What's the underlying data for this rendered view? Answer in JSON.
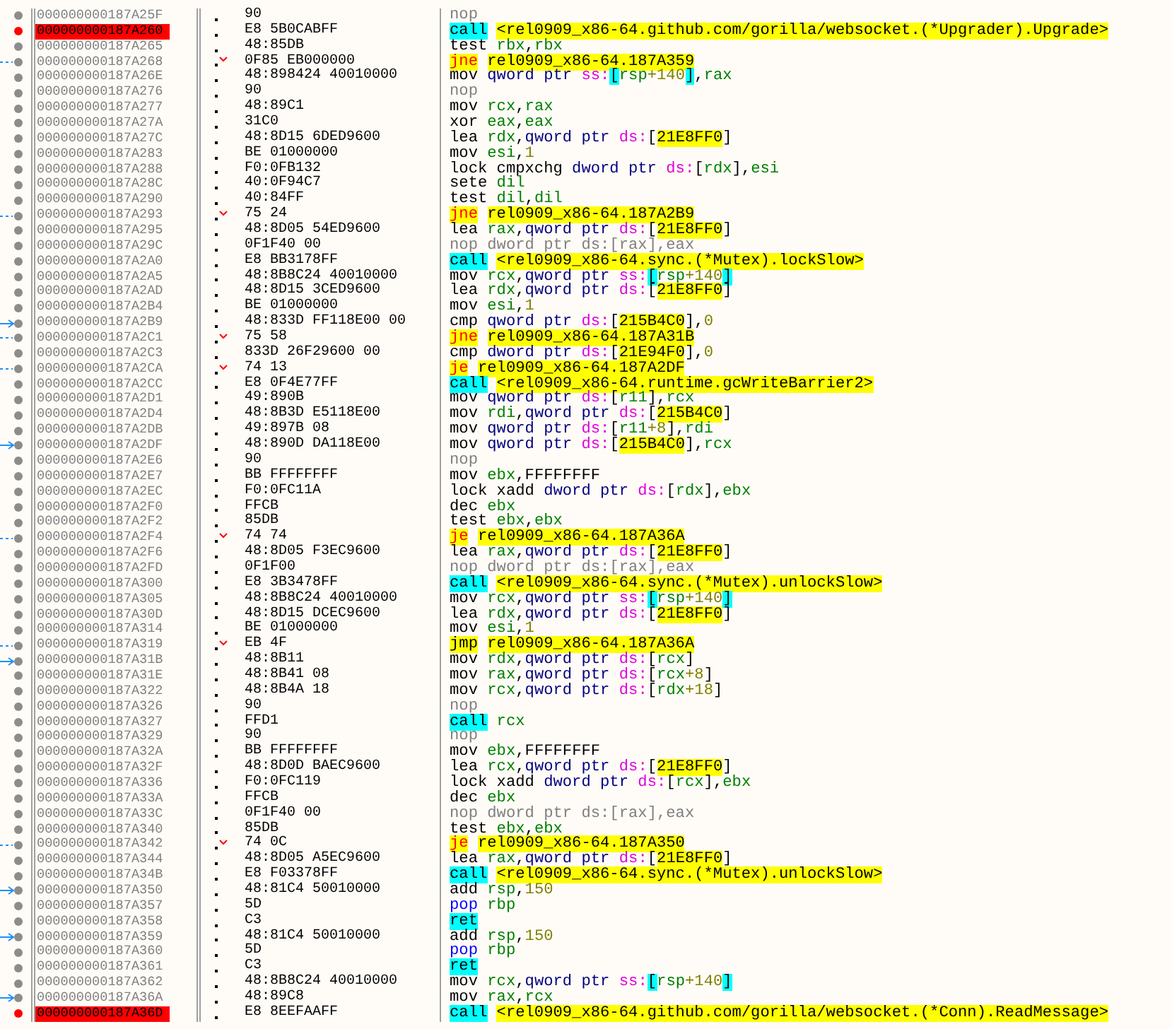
{
  "rows": [
    {
      "address": "000000000187A25F",
      "bytes": "90",
      "breakpoint": false,
      "kind": "plain",
      "mnemonic": {
        "kind": "nop",
        "text": "nop"
      },
      "operands": []
    },
    {
      "address": "000000000187A260",
      "bytes": "E8 5B0CABFF",
      "breakpoint": true,
      "kind": "plain",
      "mnemonic": {
        "kind": "call",
        "text": "call"
      },
      "operands": [
        {
          "kind": "label",
          "text": "<rel0909_x86-64.github.com/gorilla/websocket.(*Upgrader).Upgrade>"
        }
      ]
    },
    {
      "address": "000000000187A265",
      "bytes": "48:85DB",
      "breakpoint": false,
      "kind": "plain",
      "mnemonic": {
        "kind": "op",
        "text": "test"
      },
      "operands": [
        {
          "kind": "reg",
          "text": "rbx"
        },
        {
          "kind": "op",
          "text": ","
        },
        {
          "kind": "reg",
          "text": "rbx"
        }
      ]
    },
    {
      "address": "000000000187A268",
      "bytes": "0F85 EB000000",
      "breakpoint": false,
      "kind": "jump",
      "mnemonic": {
        "kind": "jcc",
        "text": "jne"
      },
      "operands": [
        {
          "kind": "label",
          "text": "rel0909_x86-64.187A359"
        }
      ]
    },
    {
      "address": "000000000187A26E",
      "bytes": "48:898424 40010000",
      "breakpoint": false,
      "kind": "plain",
      "mnemonic": {
        "kind": "op",
        "text": "mov"
      },
      "operands": [
        {
          "kind": "size",
          "text": "qword ptr "
        },
        {
          "kind": "seg",
          "text": "ss:"
        },
        {
          "kind": "sbr",
          "text": "["
        },
        {
          "kind": "reg",
          "text": "rsp"
        },
        {
          "kind": "num",
          "text": "+140"
        },
        {
          "kind": "sbr",
          "text": "]"
        },
        {
          "kind": "op",
          "text": ","
        },
        {
          "kind": "reg",
          "text": "rax"
        }
      ]
    },
    {
      "address": "000000000187A276",
      "bytes": "90",
      "breakpoint": false,
      "kind": "plain",
      "mnemonic": {
        "kind": "nop",
        "text": "nop"
      },
      "operands": []
    },
    {
      "address": "000000000187A277",
      "bytes": "48:89C1",
      "breakpoint": false,
      "kind": "plain",
      "mnemonic": {
        "kind": "op",
        "text": "mov"
      },
      "operands": [
        {
          "kind": "reg",
          "text": "rcx"
        },
        {
          "kind": "op",
          "text": ","
        },
        {
          "kind": "reg",
          "text": "rax"
        }
      ]
    },
    {
      "address": "000000000187A27A",
      "bytes": "31C0",
      "breakpoint": false,
      "kind": "plain",
      "mnemonic": {
        "kind": "op",
        "text": "xor"
      },
      "operands": [
        {
          "kind": "reg",
          "text": "eax"
        },
        {
          "kind": "op",
          "text": ","
        },
        {
          "kind": "reg",
          "text": "eax"
        }
      ]
    },
    {
      "address": "000000000187A27C",
      "bytes": "48:8D15 6DED9600",
      "breakpoint": false,
      "kind": "plain",
      "mnemonic": {
        "kind": "op",
        "text": "lea"
      },
      "operands": [
        {
          "kind": "reg",
          "text": "rdx"
        },
        {
          "kind": "op",
          "text": ","
        },
        {
          "kind": "size",
          "text": "qword ptr "
        },
        {
          "kind": "seg",
          "text": "ds:"
        },
        {
          "kind": "op",
          "text": "["
        },
        {
          "kind": "addr",
          "text": "21E8FF0"
        },
        {
          "kind": "op",
          "text": "]"
        }
      ]
    },
    {
      "address": "000000000187A283",
      "bytes": "BE 01000000",
      "breakpoint": false,
      "kind": "plain",
      "mnemonic": {
        "kind": "op",
        "text": "mov"
      },
      "operands": [
        {
          "kind": "reg",
          "text": "esi"
        },
        {
          "kind": "op",
          "text": ","
        },
        {
          "kind": "num",
          "text": "1"
        }
      ]
    },
    {
      "address": "000000000187A288",
      "bytes": "F0:0FB132",
      "breakpoint": false,
      "kind": "plain",
      "mnemonic": {
        "kind": "op",
        "text": "lock cmpxchg"
      },
      "operands": [
        {
          "kind": "size",
          "text": "dword ptr "
        },
        {
          "kind": "seg",
          "text": "ds:"
        },
        {
          "kind": "op",
          "text": "["
        },
        {
          "kind": "reg",
          "text": "rdx"
        },
        {
          "kind": "op",
          "text": "],"
        },
        {
          "kind": "reg",
          "text": "esi"
        }
      ]
    },
    {
      "address": "000000000187A28C",
      "bytes": "40:0F94C7",
      "breakpoint": false,
      "kind": "plain",
      "mnemonic": {
        "kind": "op",
        "text": "sete"
      },
      "operands": [
        {
          "kind": "reg",
          "text": "dil"
        }
      ]
    },
    {
      "address": "000000000187A290",
      "bytes": "40:84FF",
      "breakpoint": false,
      "kind": "plain",
      "mnemonic": {
        "kind": "op",
        "text": "test"
      },
      "operands": [
        {
          "kind": "reg",
          "text": "dil"
        },
        {
          "kind": "op",
          "text": ","
        },
        {
          "kind": "reg",
          "text": "dil"
        }
      ]
    },
    {
      "address": "000000000187A293",
      "bytes": "75 24",
      "breakpoint": false,
      "kind": "jump",
      "mnemonic": {
        "kind": "jcc",
        "text": "jne"
      },
      "operands": [
        {
          "kind": "label",
          "text": "rel0909_x86-64.187A2B9"
        }
      ]
    },
    {
      "address": "000000000187A295",
      "bytes": "48:8D05 54ED9600",
      "breakpoint": false,
      "kind": "plain",
      "mnemonic": {
        "kind": "op",
        "text": "lea"
      },
      "operands": [
        {
          "kind": "reg",
          "text": "rax"
        },
        {
          "kind": "op",
          "text": ","
        },
        {
          "kind": "size",
          "text": "qword ptr "
        },
        {
          "kind": "seg",
          "text": "ds:"
        },
        {
          "kind": "op",
          "text": "["
        },
        {
          "kind": "addr",
          "text": "21E8FF0"
        },
        {
          "kind": "op",
          "text": "]"
        }
      ]
    },
    {
      "address": "000000000187A29C",
      "bytes": "0F1F40 00",
      "breakpoint": false,
      "kind": "plain",
      "mnemonic": {
        "kind": "nop",
        "text": "nop"
      },
      "operands": [
        {
          "kind": "nop",
          "text": "dword ptr ds:[rax],eax"
        }
      ]
    },
    {
      "address": "000000000187A2A0",
      "bytes": "E8 BB3178FF",
      "breakpoint": false,
      "kind": "plain",
      "mnemonic": {
        "kind": "call",
        "text": "call"
      },
      "operands": [
        {
          "kind": "label",
          "text": "<rel0909_x86-64.sync.(*Mutex).lockSlow>"
        }
      ]
    },
    {
      "address": "000000000187A2A5",
      "bytes": "48:8B8C24 40010000",
      "breakpoint": false,
      "kind": "plain",
      "mnemonic": {
        "kind": "op",
        "text": "mov"
      },
      "operands": [
        {
          "kind": "reg",
          "text": "rcx"
        },
        {
          "kind": "op",
          "text": ","
        },
        {
          "kind": "size",
          "text": "qword ptr "
        },
        {
          "kind": "seg",
          "text": "ss:"
        },
        {
          "kind": "sbr",
          "text": "["
        },
        {
          "kind": "reg",
          "text": "rsp"
        },
        {
          "kind": "num",
          "text": "+140"
        },
        {
          "kind": "sbr",
          "text": "]"
        }
      ]
    },
    {
      "address": "000000000187A2AD",
      "bytes": "48:8D15 3CED9600",
      "breakpoint": false,
      "kind": "plain",
      "mnemonic": {
        "kind": "op",
        "text": "lea"
      },
      "operands": [
        {
          "kind": "reg",
          "text": "rdx"
        },
        {
          "kind": "op",
          "text": ","
        },
        {
          "kind": "size",
          "text": "qword ptr "
        },
        {
          "kind": "seg",
          "text": "ds:"
        },
        {
          "kind": "op",
          "text": "["
        },
        {
          "kind": "addr",
          "text": "21E8FF0"
        },
        {
          "kind": "op",
          "text": "]"
        }
      ]
    },
    {
      "address": "000000000187A2B4",
      "bytes": "BE 01000000",
      "breakpoint": false,
      "kind": "plain",
      "mnemonic": {
        "kind": "op",
        "text": "mov"
      },
      "operands": [
        {
          "kind": "reg",
          "text": "esi"
        },
        {
          "kind": "op",
          "text": ","
        },
        {
          "kind": "num",
          "text": "1"
        }
      ]
    },
    {
      "address": "000000000187A2B9",
      "bytes": "48:833D FF118E00 00",
      "breakpoint": false,
      "kind": "target",
      "mnemonic": {
        "kind": "op",
        "text": "cmp"
      },
      "operands": [
        {
          "kind": "size",
          "text": "qword ptr "
        },
        {
          "kind": "seg",
          "text": "ds:"
        },
        {
          "kind": "op",
          "text": "["
        },
        {
          "kind": "addr",
          "text": "215B4C0"
        },
        {
          "kind": "op",
          "text": "],"
        },
        {
          "kind": "num",
          "text": "0"
        }
      ]
    },
    {
      "address": "000000000187A2C1",
      "bytes": "75 58",
      "breakpoint": false,
      "kind": "jump",
      "mnemonic": {
        "kind": "jcc",
        "text": "jne"
      },
      "operands": [
        {
          "kind": "label",
          "text": "rel0909_x86-64.187A31B"
        }
      ]
    },
    {
      "address": "000000000187A2C3",
      "bytes": "833D 26F29600 00",
      "breakpoint": false,
      "kind": "plain",
      "mnemonic": {
        "kind": "op",
        "text": "cmp"
      },
      "operands": [
        {
          "kind": "size",
          "text": "dword ptr "
        },
        {
          "kind": "seg",
          "text": "ds:"
        },
        {
          "kind": "op",
          "text": "["
        },
        {
          "kind": "addr",
          "text": "21E94F0"
        },
        {
          "kind": "op",
          "text": "],"
        },
        {
          "kind": "num",
          "text": "0"
        }
      ]
    },
    {
      "address": "000000000187A2CA",
      "bytes": "74 13",
      "breakpoint": false,
      "kind": "jump",
      "mnemonic": {
        "kind": "jcc",
        "text": "je"
      },
      "operands": [
        {
          "kind": "label",
          "text": "rel0909_x86-64.187A2DF"
        }
      ]
    },
    {
      "address": "000000000187A2CC",
      "bytes": "E8 0F4E77FF",
      "breakpoint": false,
      "kind": "plain",
      "mnemonic": {
        "kind": "call",
        "text": "call"
      },
      "operands": [
        {
          "kind": "label",
          "text": "<rel0909_x86-64.runtime.gcWriteBarrier2>"
        }
      ]
    },
    {
      "address": "000000000187A2D1",
      "bytes": "49:890B",
      "breakpoint": false,
      "kind": "plain",
      "mnemonic": {
        "kind": "op",
        "text": "mov"
      },
      "operands": [
        {
          "kind": "size",
          "text": "qword ptr "
        },
        {
          "kind": "seg",
          "text": "ds:"
        },
        {
          "kind": "op",
          "text": "["
        },
        {
          "kind": "reg",
          "text": "r11"
        },
        {
          "kind": "op",
          "text": "],"
        },
        {
          "kind": "reg",
          "text": "rcx"
        }
      ]
    },
    {
      "address": "000000000187A2D4",
      "bytes": "48:8B3D E5118E00",
      "breakpoint": false,
      "kind": "plain",
      "mnemonic": {
        "kind": "op",
        "text": "mov"
      },
      "operands": [
        {
          "kind": "reg",
          "text": "rdi"
        },
        {
          "kind": "op",
          "text": ","
        },
        {
          "kind": "size",
          "text": "qword ptr "
        },
        {
          "kind": "seg",
          "text": "ds:"
        },
        {
          "kind": "op",
          "text": "["
        },
        {
          "kind": "addr",
          "text": "215B4C0"
        },
        {
          "kind": "op",
          "text": "]"
        }
      ]
    },
    {
      "address": "000000000187A2DB",
      "bytes": "49:897B 08",
      "breakpoint": false,
      "kind": "plain",
      "mnemonic": {
        "kind": "op",
        "text": "mov"
      },
      "operands": [
        {
          "kind": "size",
          "text": "qword ptr "
        },
        {
          "kind": "seg",
          "text": "ds:"
        },
        {
          "kind": "op",
          "text": "["
        },
        {
          "kind": "reg",
          "text": "r11"
        },
        {
          "kind": "num",
          "text": "+8"
        },
        {
          "kind": "op",
          "text": "],"
        },
        {
          "kind": "reg",
          "text": "rdi"
        }
      ]
    },
    {
      "address": "000000000187A2DF",
      "bytes": "48:890D DA118E00",
      "breakpoint": false,
      "kind": "target",
      "mnemonic": {
        "kind": "op",
        "text": "mov"
      },
      "operands": [
        {
          "kind": "size",
          "text": "qword ptr "
        },
        {
          "kind": "seg",
          "text": "ds:"
        },
        {
          "kind": "op",
          "text": "["
        },
        {
          "kind": "addr",
          "text": "215B4C0"
        },
        {
          "kind": "op",
          "text": "],"
        },
        {
          "kind": "reg",
          "text": "rcx"
        }
      ]
    },
    {
      "address": "000000000187A2E6",
      "bytes": "90",
      "breakpoint": false,
      "kind": "plain",
      "mnemonic": {
        "kind": "nop",
        "text": "nop"
      },
      "operands": []
    },
    {
      "address": "000000000187A2E7",
      "bytes": "BB FFFFFFFF",
      "breakpoint": false,
      "kind": "plain",
      "mnemonic": {
        "kind": "op",
        "text": "mov"
      },
      "operands": [
        {
          "kind": "reg",
          "text": "ebx"
        },
        {
          "kind": "op",
          "text": ",FFFFFFFF"
        }
      ]
    },
    {
      "address": "000000000187A2EC",
      "bytes": "F0:0FC11A",
      "breakpoint": false,
      "kind": "plain",
      "mnemonic": {
        "kind": "op",
        "text": "lock xadd"
      },
      "operands": [
        {
          "kind": "size",
          "text": "dword ptr "
        },
        {
          "kind": "seg",
          "text": "ds:"
        },
        {
          "kind": "op",
          "text": "["
        },
        {
          "kind": "reg",
          "text": "rdx"
        },
        {
          "kind": "op",
          "text": "],"
        },
        {
          "kind": "reg",
          "text": "ebx"
        }
      ]
    },
    {
      "address": "000000000187A2F0",
      "bytes": "FFCB",
      "breakpoint": false,
      "kind": "plain",
      "mnemonic": {
        "kind": "op",
        "text": "dec"
      },
      "operands": [
        {
          "kind": "reg",
          "text": "ebx"
        }
      ]
    },
    {
      "address": "000000000187A2F2",
      "bytes": "85DB",
      "breakpoint": false,
      "kind": "plain",
      "mnemonic": {
        "kind": "op",
        "text": "test"
      },
      "operands": [
        {
          "kind": "reg",
          "text": "ebx"
        },
        {
          "kind": "op",
          "text": ","
        },
        {
          "kind": "reg",
          "text": "ebx"
        }
      ]
    },
    {
      "address": "000000000187A2F4",
      "bytes": "74 74",
      "breakpoint": false,
      "kind": "jump",
      "mnemonic": {
        "kind": "jcc",
        "text": "je"
      },
      "operands": [
        {
          "kind": "label",
          "text": "rel0909_x86-64.187A36A"
        }
      ]
    },
    {
      "address": "000000000187A2F6",
      "bytes": "48:8D05 F3EC9600",
      "breakpoint": false,
      "kind": "plain",
      "mnemonic": {
        "kind": "op",
        "text": "lea"
      },
      "operands": [
        {
          "kind": "reg",
          "text": "rax"
        },
        {
          "kind": "op",
          "text": ","
        },
        {
          "kind": "size",
          "text": "qword ptr "
        },
        {
          "kind": "seg",
          "text": "ds:"
        },
        {
          "kind": "op",
          "text": "["
        },
        {
          "kind": "addr",
          "text": "21E8FF0"
        },
        {
          "kind": "op",
          "text": "]"
        }
      ]
    },
    {
      "address": "000000000187A2FD",
      "bytes": "0F1F00",
      "breakpoint": false,
      "kind": "plain",
      "mnemonic": {
        "kind": "nop",
        "text": "nop"
      },
      "operands": [
        {
          "kind": "nop",
          "text": "dword ptr ds:[rax],eax"
        }
      ]
    },
    {
      "address": "000000000187A300",
      "bytes": "E8 3B3478FF",
      "breakpoint": false,
      "kind": "plain",
      "mnemonic": {
        "kind": "call",
        "text": "call"
      },
      "operands": [
        {
          "kind": "label",
          "text": "<rel0909_x86-64.sync.(*Mutex).unlockSlow>"
        }
      ]
    },
    {
      "address": "000000000187A305",
      "bytes": "48:8B8C24 40010000",
      "breakpoint": false,
      "kind": "plain",
      "mnemonic": {
        "kind": "op",
        "text": "mov"
      },
      "operands": [
        {
          "kind": "reg",
          "text": "rcx"
        },
        {
          "kind": "op",
          "text": ","
        },
        {
          "kind": "size",
          "text": "qword ptr "
        },
        {
          "kind": "seg",
          "text": "ss:"
        },
        {
          "kind": "sbr",
          "text": "["
        },
        {
          "kind": "reg",
          "text": "rsp"
        },
        {
          "kind": "num",
          "text": "+140"
        },
        {
          "kind": "sbr",
          "text": "]"
        }
      ]
    },
    {
      "address": "000000000187A30D",
      "bytes": "48:8D15 DCEC9600",
      "breakpoint": false,
      "kind": "plain",
      "mnemonic": {
        "kind": "op",
        "text": "lea"
      },
      "operands": [
        {
          "kind": "reg",
          "text": "rdx"
        },
        {
          "kind": "op",
          "text": ","
        },
        {
          "kind": "size",
          "text": "qword ptr "
        },
        {
          "kind": "seg",
          "text": "ds:"
        },
        {
          "kind": "op",
          "text": "["
        },
        {
          "kind": "addr",
          "text": "21E8FF0"
        },
        {
          "kind": "op",
          "text": "]"
        }
      ]
    },
    {
      "address": "000000000187A314",
      "bytes": "BE 01000000",
      "breakpoint": false,
      "kind": "plain",
      "mnemonic": {
        "kind": "op",
        "text": "mov"
      },
      "operands": [
        {
          "kind": "reg",
          "text": "esi"
        },
        {
          "kind": "op",
          "text": ","
        },
        {
          "kind": "num",
          "text": "1"
        }
      ]
    },
    {
      "address": "000000000187A319",
      "bytes": "EB 4F",
      "breakpoint": false,
      "kind": "jump",
      "mnemonic": {
        "kind": "jmp",
        "text": "jmp"
      },
      "operands": [
        {
          "kind": "label",
          "text": "rel0909_x86-64.187A36A"
        }
      ]
    },
    {
      "address": "000000000187A31B",
      "bytes": "48:8B11",
      "breakpoint": false,
      "kind": "target",
      "mnemonic": {
        "kind": "op",
        "text": "mov"
      },
      "operands": [
        {
          "kind": "reg",
          "text": "rdx"
        },
        {
          "kind": "op",
          "text": ","
        },
        {
          "kind": "size",
          "text": "qword ptr "
        },
        {
          "kind": "seg",
          "text": "ds:"
        },
        {
          "kind": "op",
          "text": "["
        },
        {
          "kind": "reg",
          "text": "rcx"
        },
        {
          "kind": "op",
          "text": "]"
        }
      ]
    },
    {
      "address": "000000000187A31E",
      "bytes": "48:8B41 08",
      "breakpoint": false,
      "kind": "plain",
      "mnemonic": {
        "kind": "op",
        "text": "mov"
      },
      "operands": [
        {
          "kind": "reg",
          "text": "rax"
        },
        {
          "kind": "op",
          "text": ","
        },
        {
          "kind": "size",
          "text": "qword ptr "
        },
        {
          "kind": "seg",
          "text": "ds:"
        },
        {
          "kind": "op",
          "text": "["
        },
        {
          "kind": "reg",
          "text": "rcx"
        },
        {
          "kind": "num",
          "text": "+8"
        },
        {
          "kind": "op",
          "text": "]"
        }
      ]
    },
    {
      "address": "000000000187A322",
      "bytes": "48:8B4A 18",
      "breakpoint": false,
      "kind": "plain",
      "mnemonic": {
        "kind": "op",
        "text": "mov"
      },
      "operands": [
        {
          "kind": "reg",
          "text": "rcx"
        },
        {
          "kind": "op",
          "text": ","
        },
        {
          "kind": "size",
          "text": "qword ptr "
        },
        {
          "kind": "seg",
          "text": "ds:"
        },
        {
          "kind": "op",
          "text": "["
        },
        {
          "kind": "reg",
          "text": "rdx"
        },
        {
          "kind": "num",
          "text": "+18"
        },
        {
          "kind": "op",
          "text": "]"
        }
      ]
    },
    {
      "address": "000000000187A326",
      "bytes": "90",
      "breakpoint": false,
      "kind": "plain",
      "mnemonic": {
        "kind": "nop",
        "text": "nop"
      },
      "operands": []
    },
    {
      "address": "000000000187A327",
      "bytes": "FFD1",
      "breakpoint": false,
      "kind": "plain",
      "mnemonic": {
        "kind": "call",
        "text": "call"
      },
      "operands": [
        {
          "kind": "reg",
          "text": "rcx"
        }
      ]
    },
    {
      "address": "000000000187A329",
      "bytes": "90",
      "breakpoint": false,
      "kind": "plain",
      "mnemonic": {
        "kind": "nop",
        "text": "nop"
      },
      "operands": []
    },
    {
      "address": "000000000187A32A",
      "bytes": "BB FFFFFFFF",
      "breakpoint": false,
      "kind": "plain",
      "mnemonic": {
        "kind": "op",
        "text": "mov"
      },
      "operands": [
        {
          "kind": "reg",
          "text": "ebx"
        },
        {
          "kind": "op",
          "text": ",FFFFFFFF"
        }
      ]
    },
    {
      "address": "000000000187A32F",
      "bytes": "48:8D0D BAEC9600",
      "breakpoint": false,
      "kind": "plain",
      "mnemonic": {
        "kind": "op",
        "text": "lea"
      },
      "operands": [
        {
          "kind": "reg",
          "text": "rcx"
        },
        {
          "kind": "op",
          "text": ","
        },
        {
          "kind": "size",
          "text": "qword ptr "
        },
        {
          "kind": "seg",
          "text": "ds:"
        },
        {
          "kind": "op",
          "text": "["
        },
        {
          "kind": "addr",
          "text": "21E8FF0"
        },
        {
          "kind": "op",
          "text": "]"
        }
      ]
    },
    {
      "address": "000000000187A336",
      "bytes": "F0:0FC119",
      "breakpoint": false,
      "kind": "plain",
      "mnemonic": {
        "kind": "op",
        "text": "lock xadd"
      },
      "operands": [
        {
          "kind": "size",
          "text": "dword ptr "
        },
        {
          "kind": "seg",
          "text": "ds:"
        },
        {
          "kind": "op",
          "text": "["
        },
        {
          "kind": "reg",
          "text": "rcx"
        },
        {
          "kind": "op",
          "text": "],"
        },
        {
          "kind": "reg",
          "text": "ebx"
        }
      ]
    },
    {
      "address": "000000000187A33A",
      "bytes": "FFCB",
      "breakpoint": false,
      "kind": "plain",
      "mnemonic": {
        "kind": "op",
        "text": "dec"
      },
      "operands": [
        {
          "kind": "reg",
          "text": "ebx"
        }
      ]
    },
    {
      "address": "000000000187A33C",
      "bytes": "0F1F40 00",
      "breakpoint": false,
      "kind": "plain",
      "mnemonic": {
        "kind": "nop",
        "text": "nop"
      },
      "operands": [
        {
          "kind": "nop",
          "text": "dword ptr ds:[rax],eax"
        }
      ]
    },
    {
      "address": "000000000187A340",
      "bytes": "85DB",
      "breakpoint": false,
      "kind": "plain",
      "mnemonic": {
        "kind": "op",
        "text": "test"
      },
      "operands": [
        {
          "kind": "reg",
          "text": "ebx"
        },
        {
          "kind": "op",
          "text": ","
        },
        {
          "kind": "reg",
          "text": "ebx"
        }
      ]
    },
    {
      "address": "000000000187A342",
      "bytes": "74 0C",
      "breakpoint": false,
      "kind": "jump",
      "mnemonic": {
        "kind": "jcc",
        "text": "je"
      },
      "operands": [
        {
          "kind": "label",
          "text": "rel0909_x86-64.187A350"
        }
      ]
    },
    {
      "address": "000000000187A344",
      "bytes": "48:8D05 A5EC9600",
      "breakpoint": false,
      "kind": "plain",
      "mnemonic": {
        "kind": "op",
        "text": "lea"
      },
      "operands": [
        {
          "kind": "reg",
          "text": "rax"
        },
        {
          "kind": "op",
          "text": ","
        },
        {
          "kind": "size",
          "text": "qword ptr "
        },
        {
          "kind": "seg",
          "text": "ds:"
        },
        {
          "kind": "op",
          "text": "["
        },
        {
          "kind": "addr",
          "text": "21E8FF0"
        },
        {
          "kind": "op",
          "text": "]"
        }
      ]
    },
    {
      "address": "000000000187A34B",
      "bytes": "E8 F03378FF",
      "breakpoint": false,
      "kind": "plain",
      "mnemonic": {
        "kind": "call",
        "text": "call"
      },
      "operands": [
        {
          "kind": "label",
          "text": "<rel0909_x86-64.sync.(*Mutex).unlockSlow>"
        }
      ]
    },
    {
      "address": "000000000187A350",
      "bytes": "48:81C4 50010000",
      "breakpoint": false,
      "kind": "target",
      "mnemonic": {
        "kind": "op",
        "text": "add"
      },
      "operands": [
        {
          "kind": "reg",
          "text": "rsp"
        },
        {
          "kind": "op",
          "text": ","
        },
        {
          "kind": "num",
          "text": "150"
        }
      ]
    },
    {
      "address": "000000000187A357",
      "bytes": "5D",
      "breakpoint": false,
      "kind": "plain",
      "mnemonic": {
        "kind": "stack",
        "text": "pop"
      },
      "operands": [
        {
          "kind": "reg",
          "text": "rbp"
        }
      ]
    },
    {
      "address": "000000000187A358",
      "bytes": "C3",
      "breakpoint": false,
      "kind": "plain",
      "mnemonic": {
        "kind": "ret",
        "text": "ret"
      },
      "operands": []
    },
    {
      "address": "000000000187A359",
      "bytes": "48:81C4 50010000",
      "breakpoint": false,
      "kind": "target",
      "mnemonic": {
        "kind": "op",
        "text": "add"
      },
      "operands": [
        {
          "kind": "reg",
          "text": "rsp"
        },
        {
          "kind": "op",
          "text": ","
        },
        {
          "kind": "num",
          "text": "150"
        }
      ]
    },
    {
      "address": "000000000187A360",
      "bytes": "5D",
      "breakpoint": false,
      "kind": "plain",
      "mnemonic": {
        "kind": "stack",
        "text": "pop"
      },
      "operands": [
        {
          "kind": "reg",
          "text": "rbp"
        }
      ]
    },
    {
      "address": "000000000187A361",
      "bytes": "C3",
      "breakpoint": false,
      "kind": "plain",
      "mnemonic": {
        "kind": "ret",
        "text": "ret"
      },
      "operands": []
    },
    {
      "address": "000000000187A362",
      "bytes": "48:8B8C24 40010000",
      "breakpoint": false,
      "kind": "plain",
      "mnemonic": {
        "kind": "op",
        "text": "mov"
      },
      "operands": [
        {
          "kind": "reg",
          "text": "rcx"
        },
        {
          "kind": "op",
          "text": ","
        },
        {
          "kind": "size",
          "text": "qword ptr "
        },
        {
          "kind": "seg",
          "text": "ss:"
        },
        {
          "kind": "sbr",
          "text": "["
        },
        {
          "kind": "reg",
          "text": "rsp"
        },
        {
          "kind": "num",
          "text": "+140"
        },
        {
          "kind": "sbr",
          "text": "]"
        }
      ]
    },
    {
      "address": "000000000187A36A",
      "bytes": "48:89C8",
      "breakpoint": false,
      "kind": "target",
      "mnemonic": {
        "kind": "op",
        "text": "mov"
      },
      "operands": [
        {
          "kind": "reg",
          "text": "rax"
        },
        {
          "kind": "op",
          "text": ","
        },
        {
          "kind": "reg",
          "text": "rcx"
        }
      ]
    },
    {
      "address": "000000000187A36D",
      "bytes": "E8 8EEFAAFF",
      "breakpoint": true,
      "kind": "plain",
      "mnemonic": {
        "kind": "call",
        "text": "call"
      },
      "operands": [
        {
          "kind": "label",
          "text": "<rel0909_x86-64.github.com/gorilla/websocket.(*Conn).ReadMessage>"
        }
      ]
    }
  ]
}
